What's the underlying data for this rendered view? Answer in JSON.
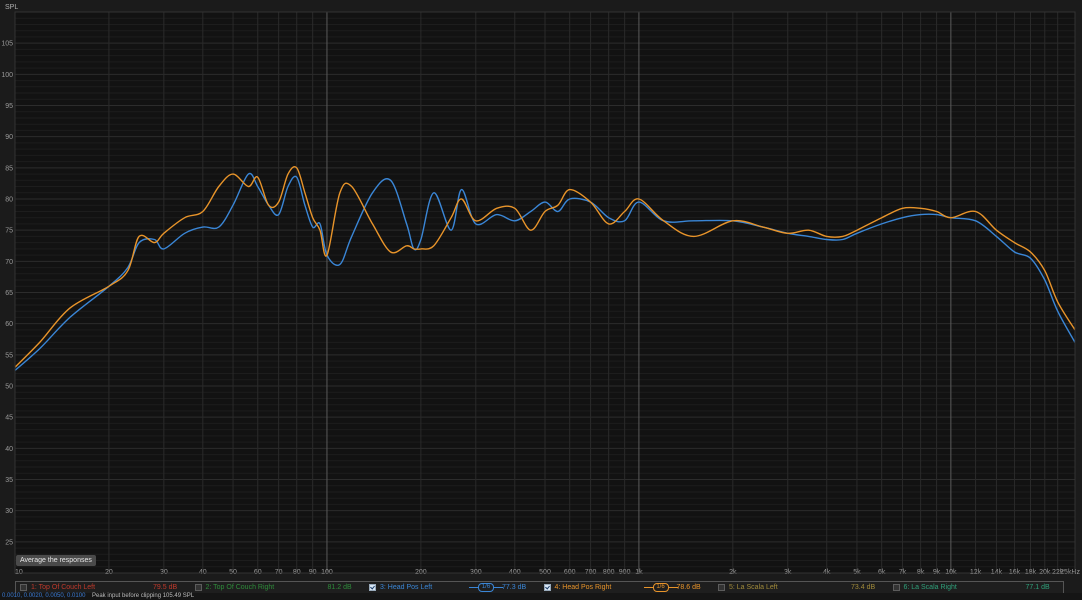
{
  "chart_data": {
    "type": "line",
    "title": "",
    "ylabel": "SPL",
    "xlabel": "",
    "x_scale": "log",
    "xlim": [
      10,
      25000
    ],
    "ylim": [
      20,
      110
    ],
    "y_ticks": [
      25,
      30,
      35,
      40,
      45,
      50,
      55,
      60,
      65,
      70,
      75,
      80,
      85,
      90,
      95,
      100,
      105
    ],
    "x_ticks": [
      {
        "v": 10,
        "label": "10"
      },
      {
        "v": 20,
        "label": "20"
      },
      {
        "v": 30,
        "label": "30"
      },
      {
        "v": 40,
        "label": "40"
      },
      {
        "v": 50,
        "label": "50"
      },
      {
        "v": 60,
        "label": "60"
      },
      {
        "v": 70,
        "label": "70"
      },
      {
        "v": 80,
        "label": "80"
      },
      {
        "v": 90,
        "label": "90"
      },
      {
        "v": 100,
        "label": "100"
      },
      {
        "v": 200,
        "label": "200"
      },
      {
        "v": 300,
        "label": "300"
      },
      {
        "v": 400,
        "label": "400"
      },
      {
        "v": 500,
        "label": "500"
      },
      {
        "v": 600,
        "label": "600"
      },
      {
        "v": 700,
        "label": "700"
      },
      {
        "v": 800,
        "label": "800"
      },
      {
        "v": 900,
        "label": "900"
      },
      {
        "v": 1000,
        "label": "1k"
      },
      {
        "v": 2000,
        "label": "2k"
      },
      {
        "v": 3000,
        "label": "3k"
      },
      {
        "v": 4000,
        "label": "4k"
      },
      {
        "v": 5000,
        "label": "5k"
      },
      {
        "v": 6000,
        "label": "6k"
      },
      {
        "v": 7000,
        "label": "7k"
      },
      {
        "v": 8000,
        "label": "8k"
      },
      {
        "v": 9000,
        "label": "9k"
      },
      {
        "v": 10000,
        "label": "10k"
      },
      {
        "v": 12000,
        "label": "12k"
      },
      {
        "v": 14000,
        "label": "14k"
      },
      {
        "v": 16000,
        "label": "16k"
      },
      {
        "v": 18000,
        "label": "18k"
      },
      {
        "v": 20000,
        "label": "20k"
      },
      {
        "v": 22000,
        "label": "22k"
      },
      {
        "v": 25000,
        "label": "25kHz"
      }
    ],
    "grid": true,
    "legend_placement": "bottom",
    "series": [
      {
        "name": "Head Pos Left",
        "color": "#3a86d6",
        "x": [
          10,
          12,
          15,
          20,
          23,
          25,
          28,
          30,
          35,
          40,
          45,
          50,
          56,
          60,
          65,
          70,
          75,
          80,
          85,
          90,
          95,
          100,
          110,
          120,
          140,
          160,
          180,
          190,
          200,
          220,
          250,
          270,
          300,
          350,
          400,
          450,
          500,
          550,
          600,
          700,
          800,
          900,
          1000,
          1200,
          1500,
          2000,
          2500,
          3000,
          3500,
          4000,
          4500,
          5000,
          6000,
          7000,
          8000,
          9000,
          10000,
          12000,
          14000,
          16000,
          18000,
          20000,
          22000,
          25000
        ],
        "y": [
          52.5,
          56,
          61,
          66,
          69,
          73,
          73.5,
          72,
          74.5,
          75.5,
          75.5,
          79,
          84,
          82,
          79,
          77.5,
          82,
          83.5,
          79,
          75.5,
          76,
          71,
          69.5,
          74,
          81,
          83,
          76,
          72,
          73.5,
          81,
          75,
          81.5,
          76,
          77.5,
          76.5,
          78,
          79.5,
          78,
          80,
          79.5,
          77,
          76.5,
          79.5,
          76.5,
          76.5,
          76.5,
          75.5,
          74.5,
          74,
          73.5,
          73.5,
          74.5,
          76,
          77,
          77.5,
          77.5,
          77,
          76.5,
          74,
          71.5,
          70.5,
          67,
          62,
          57
        ]
      },
      {
        "name": "Head Pos Right",
        "color": "#e8942a",
        "x": [
          10,
          12,
          15,
          20,
          23,
          25,
          28,
          30,
          35,
          40,
          45,
          50,
          56,
          60,
          65,
          70,
          75,
          80,
          85,
          90,
          95,
          100,
          110,
          120,
          140,
          160,
          180,
          190,
          200,
          220,
          250,
          270,
          300,
          350,
          400,
          450,
          500,
          550,
          600,
          700,
          800,
          900,
          1000,
          1200,
          1500,
          2000,
          2500,
          3000,
          3500,
          4000,
          4500,
          5000,
          6000,
          7000,
          8000,
          9000,
          10000,
          12000,
          14000,
          16000,
          18000,
          20000,
          22000,
          25000
        ],
        "y": [
          53,
          57,
          62.5,
          66,
          68.5,
          74,
          73,
          74.5,
          77,
          78,
          82,
          84,
          82,
          83.5,
          79,
          79.5,
          84,
          85,
          81,
          77,
          75,
          71,
          81,
          82,
          76,
          71.5,
          72.5,
          72,
          72,
          72.5,
          77,
          80,
          76.5,
          78.5,
          78.5,
          75,
          78,
          79,
          81.5,
          79.5,
          76,
          78,
          80,
          76.5,
          74,
          76.5,
          75.5,
          74.5,
          75,
          74,
          74,
          75,
          77,
          78.5,
          78.5,
          78,
          77,
          78,
          75,
          73,
          71.5,
          68.5,
          63.5,
          59
        ]
      }
    ]
  },
  "tooltip": "Average the responses",
  "legend": {
    "items": [
      {
        "label": "1: Top Of Couch Left",
        "value": "79.5 dB",
        "color": "#c0392b",
        "checked": false
      },
      {
        "label": "2: Top Of Couch Right",
        "value": "81.2 dB",
        "color": "#2e8b3a",
        "checked": false
      },
      {
        "label": "3: Head Pos Left",
        "value": "77.3 dB",
        "color": "#3a86d6",
        "checked": true,
        "badge": "1/6"
      },
      {
        "label": "4: Head Pos Right",
        "value": "78.6 dB",
        "color": "#e8942a",
        "checked": true,
        "badge": "1/6"
      },
      {
        "label": "5: La Scala Left",
        "value": "73.4 dB",
        "color": "#a08a3a",
        "checked": false
      },
      {
        "label": "6: La Scala Right",
        "value": "77.1 dB",
        "color": "#2fa07a",
        "checked": false
      }
    ]
  },
  "status": {
    "left": "0.0010, 0.0020, 0.0050, 0.0100",
    "right": "Peak input before clipping 105.49 SPL"
  }
}
